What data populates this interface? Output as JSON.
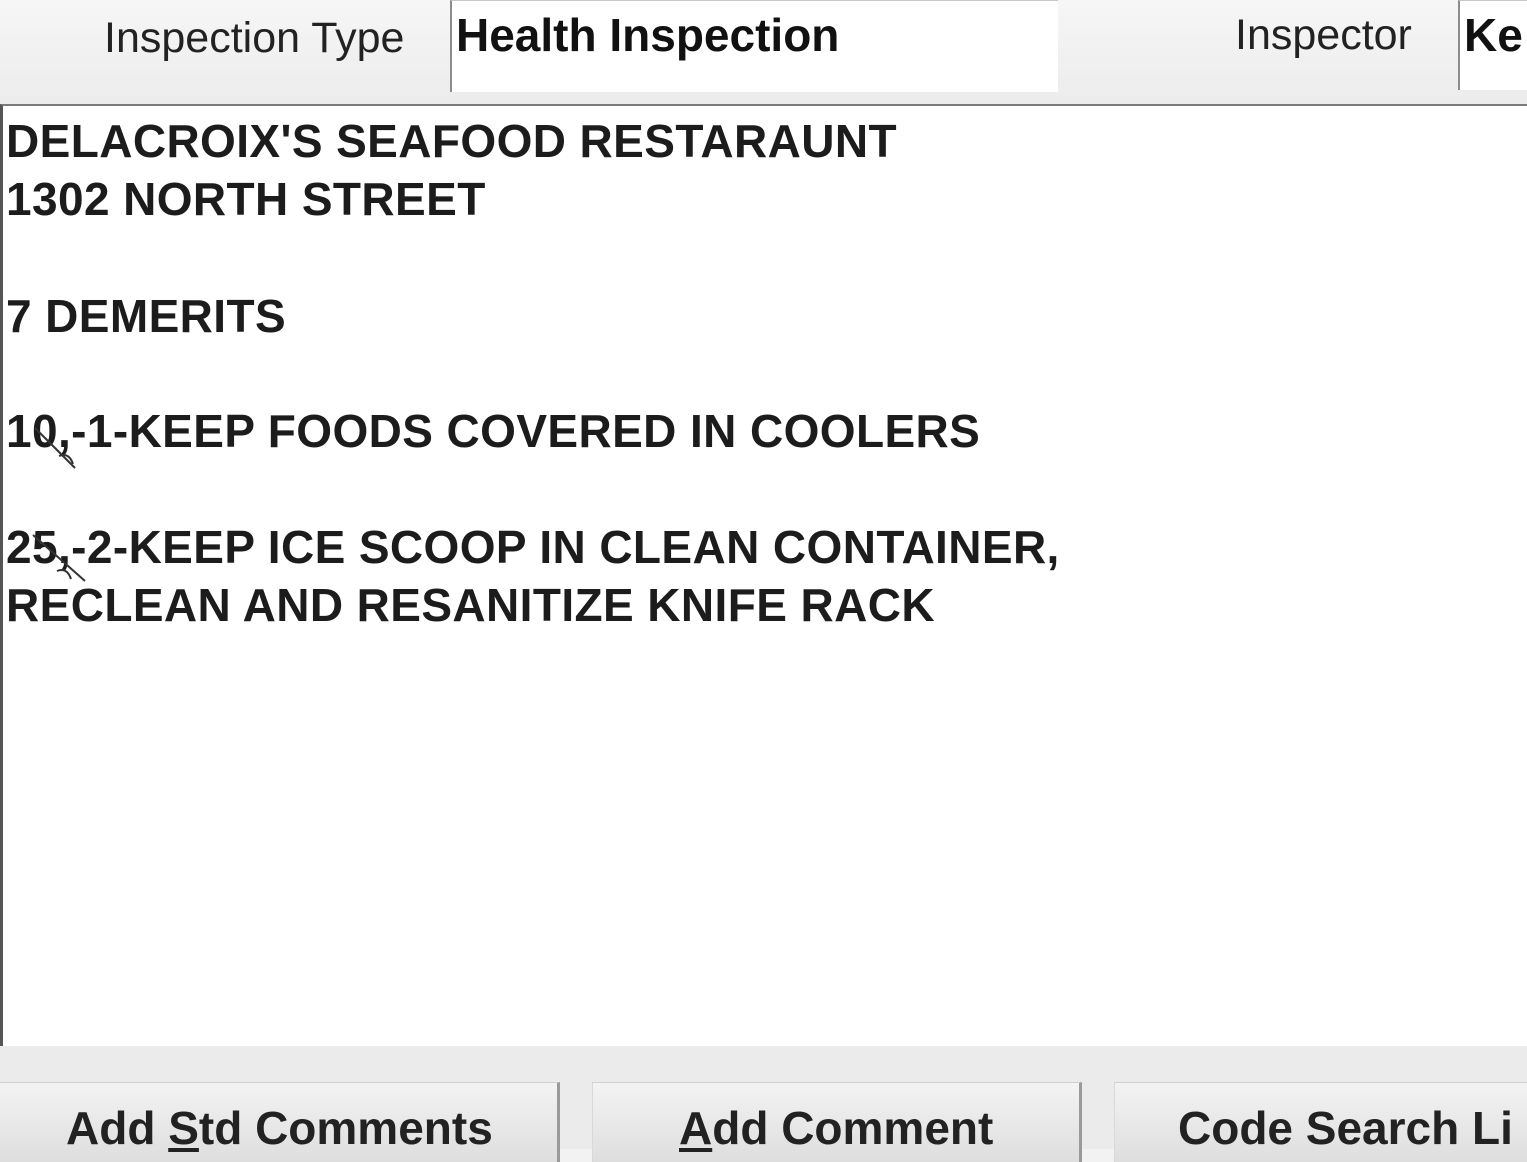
{
  "header": {
    "inspection_type_label": "Inspection Type",
    "inspection_type_value": "Health Inspection",
    "inspector_label": "Inspector",
    "inspector_value": "Ke"
  },
  "comments": {
    "lines": [
      "DELACROIX'S SEAFOOD RESTARAUNT",
      "1302 NORTH STREET",
      "",
      "7 DEMERITS",
      "",
      "10,-1-KEEP FOODS COVERED IN COOLERS",
      "",
      "25,-2-KEEP ICE SCOOP IN CLEAN CONTAINER,",
      "RECLEAN AND RESANITIZE KNIFE RACK"
    ]
  },
  "buttons": {
    "add_std_comments": {
      "pre": "Add ",
      "mnemonic": "S",
      "post": "td Comments"
    },
    "add_comment": {
      "pre": "",
      "mnemonic": "A",
      "post": "dd Comment"
    },
    "code_search": {
      "pre": "Code Search Li",
      "mnemonic": "",
      "post": ""
    }
  }
}
